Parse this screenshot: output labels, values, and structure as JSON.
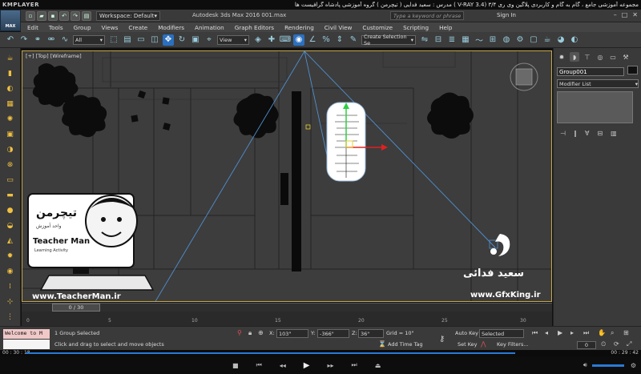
{
  "player": {
    "logo": "KMPLAYER",
    "title": "مجموعه آموزشی جامع ، گام به گام و کاربردی پلاگین وی ری V-RAY 3.4) ۳/۴ )  مدرس : سعید فدایی ( تیچرمن ) گروه آموزشی پادشاه گرافیست ها",
    "time_elapsed": "00 : 30 : 18",
    "time_total": "00 : 29 : 42",
    "progress": 0.83
  },
  "max": {
    "logo": "MAX",
    "workspace": "Workspace: Default",
    "app_title": "Autodesk 3ds Max 2016     001.max",
    "search_placeholder": "Type a keyword or phrase",
    "sign_in": "Sign In",
    "menu": [
      "Edit",
      "Tools",
      "Group",
      "Views",
      "Create",
      "Modifiers",
      "Animation",
      "Graph Editors",
      "Rendering",
      "Civil View",
      "Customize",
      "Scripting",
      "Help"
    ]
  },
  "toolbar": {
    "filter_select": "All",
    "ref_coord": "View",
    "selection_set": "Create Selection Se"
  },
  "viewport": {
    "label": "[+] [Top] [Wireframe]"
  },
  "command_panel": {
    "object_name": "Group001",
    "modifier_list": "Modifier List"
  },
  "timeline": {
    "handle": "0 / 30",
    "ticks": [
      "0",
      "5",
      "10",
      "15",
      "20",
      "25",
      "30"
    ]
  },
  "status": {
    "maxscript": "Welcome to M",
    "selected": "1 Group Selected",
    "prompt": "Click and drag to select and move objects",
    "x_label": "X:",
    "x_value": "103\"",
    "y_label": "Y:",
    "y_value": "-366\"",
    "z_label": "Z:",
    "z_value": "36\"",
    "grid": "Grid = 10\"",
    "add_time_tag": "Add Time Tag",
    "auto_key": "Auto Key",
    "set_key": "Set Key",
    "selected_dropdown": "Selected",
    "key_filters": "Key Filters...",
    "frame": "0"
  },
  "overlays": {
    "teacher_logo_fa": "تیچرمن",
    "teacher_subtitle_fa": "واحد آموزش",
    "teacher_name": "Teacher Man",
    "teacher_tag": "Learning Activity",
    "teacher_url": "www.TeacherMan.ir",
    "gfx_name": "سعید فدائی",
    "gfx_url": "www.GfxKing.ir"
  },
  "colors": {
    "accent": "#2a70c0",
    "viewport_bg": "#3d3d3d",
    "frame_border": "#c8a84a",
    "camera_line": "#4f8fd0"
  }
}
